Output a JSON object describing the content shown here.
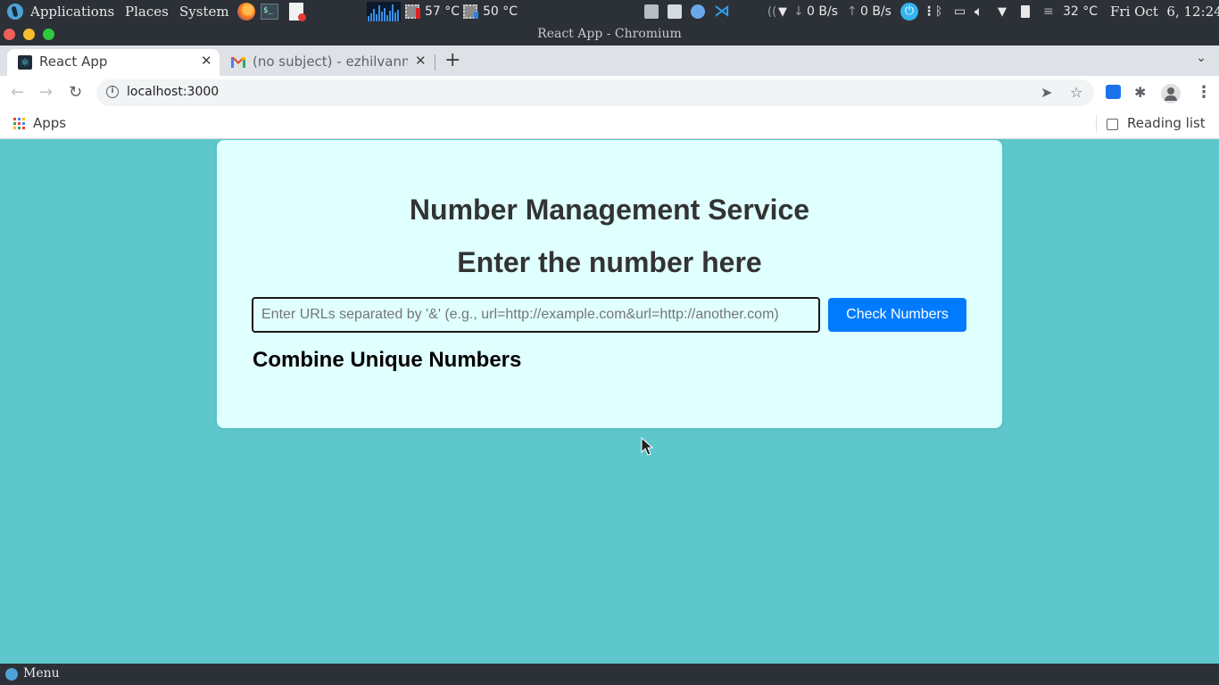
{
  "system_panel": {
    "applications": "Applications",
    "places": "Places",
    "system": "System",
    "cpu_temp_1": "57 °C",
    "cpu_temp_2": "50 °C",
    "net_down": "0 B/s",
    "net_up": "0 B/s",
    "weather_temp": "32 °C",
    "clock": "Fri Oct  6, 12:24"
  },
  "window": {
    "title": "React App - Chromium"
  },
  "tabs": [
    {
      "title": "React App",
      "favicon": "react-icon"
    },
    {
      "title": "(no subject) - ezhilvann",
      "favicon": "gmail-icon"
    }
  ],
  "toolbar": {
    "url": "localhost:3000"
  },
  "bookmarks": {
    "apps_label": "Apps",
    "reading_list_label": "Reading list"
  },
  "page": {
    "title": "Number Management Service",
    "subtitle": "Enter the number here",
    "input_placeholder": "Enter URLs separated by '&' (e.g., url=http://example.com&url=http://another.com)",
    "input_value": "",
    "button_label": "Check Numbers",
    "result_heading": "Combine Unique Numbers"
  },
  "bottom_panel": {
    "menu_label": "Menu"
  },
  "colors": {
    "page_background": "#5ec7cb",
    "card_background": "#e0ffff",
    "button": "#007bff"
  }
}
